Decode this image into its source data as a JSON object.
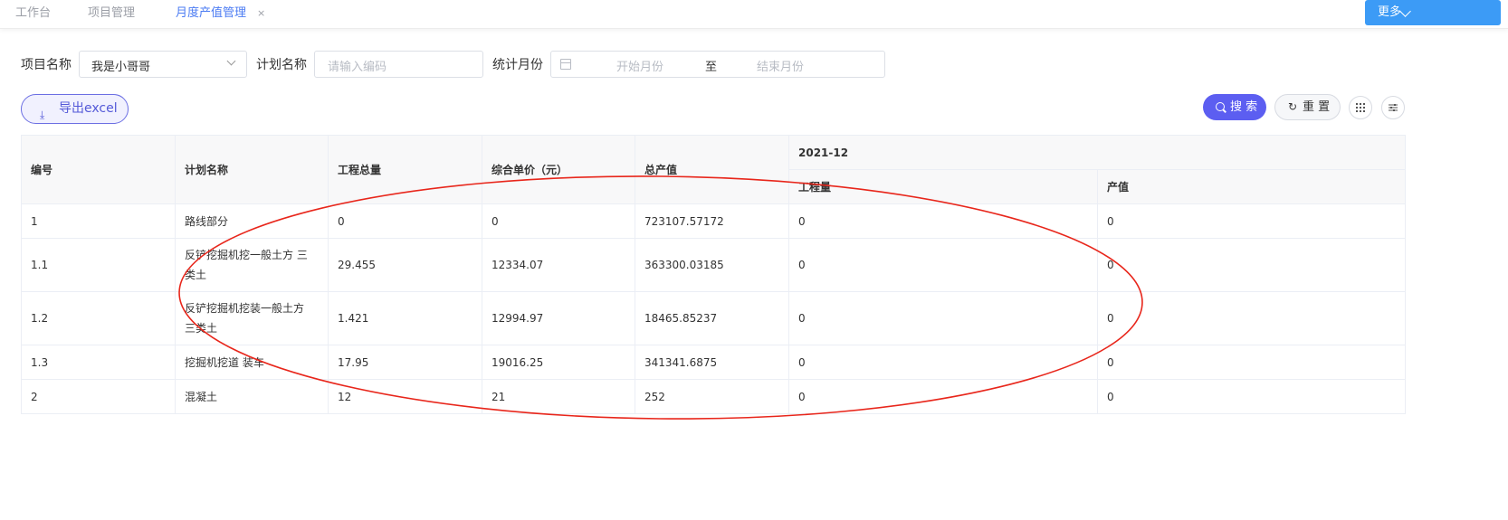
{
  "tabs": [
    {
      "label": "工作台",
      "active": false
    },
    {
      "label": "项目管理",
      "active": false
    },
    {
      "label": "月度产值管理",
      "active": true,
      "close": "×"
    }
  ],
  "more_button": {
    "label": "更多"
  },
  "filters": {
    "project_name_label": "项目名称",
    "project_name_value": "我是小哥哥",
    "plan_name_label": "计划名称",
    "plan_name_placeholder": "请输入编码",
    "stat_month_label": "统计月份",
    "start_month_placeholder": "开始月份",
    "range_separator": "至",
    "end_month_placeholder": "结束月份"
  },
  "toolbar": {
    "export_label": "导出excel",
    "search_label": "搜 索",
    "reset_label": "重 置"
  },
  "table": {
    "headers": {
      "code": "编号",
      "plan_name": "计划名称",
      "total_qty": "工程总量",
      "unit_price": "综合单价（元）",
      "total_value": "总产值",
      "month": "2021-12",
      "month_qty": "工程量",
      "month_value": "产值"
    },
    "rows": [
      {
        "code": "1",
        "name": "路线部分",
        "qty": "0",
        "price": "0",
        "total": "723107.57172",
        "mqty": "0",
        "mval": "0"
      },
      {
        "code": "1.1",
        "name": "反铲挖掘机挖一般土方 三类土",
        "qty": "29.455",
        "price": "12334.07",
        "total": "363300.03185",
        "mqty": "0",
        "mval": "0"
      },
      {
        "code": "1.2",
        "name": "反铲挖掘机挖装一般土方 三类土",
        "qty": "1.421",
        "price": "12994.97",
        "total": "18465.85237",
        "mqty": "0",
        "mval": "0"
      },
      {
        "code": "1.3",
        "name": "挖掘机挖道 装车",
        "qty": "17.95",
        "price": "19016.25",
        "total": "341341.6875",
        "mqty": "0",
        "mval": "0"
      },
      {
        "code": "2",
        "name": "混凝土",
        "qty": "12",
        "price": "21",
        "total": "252",
        "mqty": "0",
        "mval": "0"
      }
    ]
  },
  "colors": {
    "accent": "#5c5ef1",
    "tab_active": "#4c7cf3",
    "more_button": "#3c9bf6",
    "annotation": "#e8261b"
  },
  "icons": {
    "export": "download-icon",
    "search": "search-icon",
    "reset": "refresh-icon",
    "calendar": "calendar-icon",
    "columns": "grid-icon",
    "filter": "sliders-icon"
  }
}
